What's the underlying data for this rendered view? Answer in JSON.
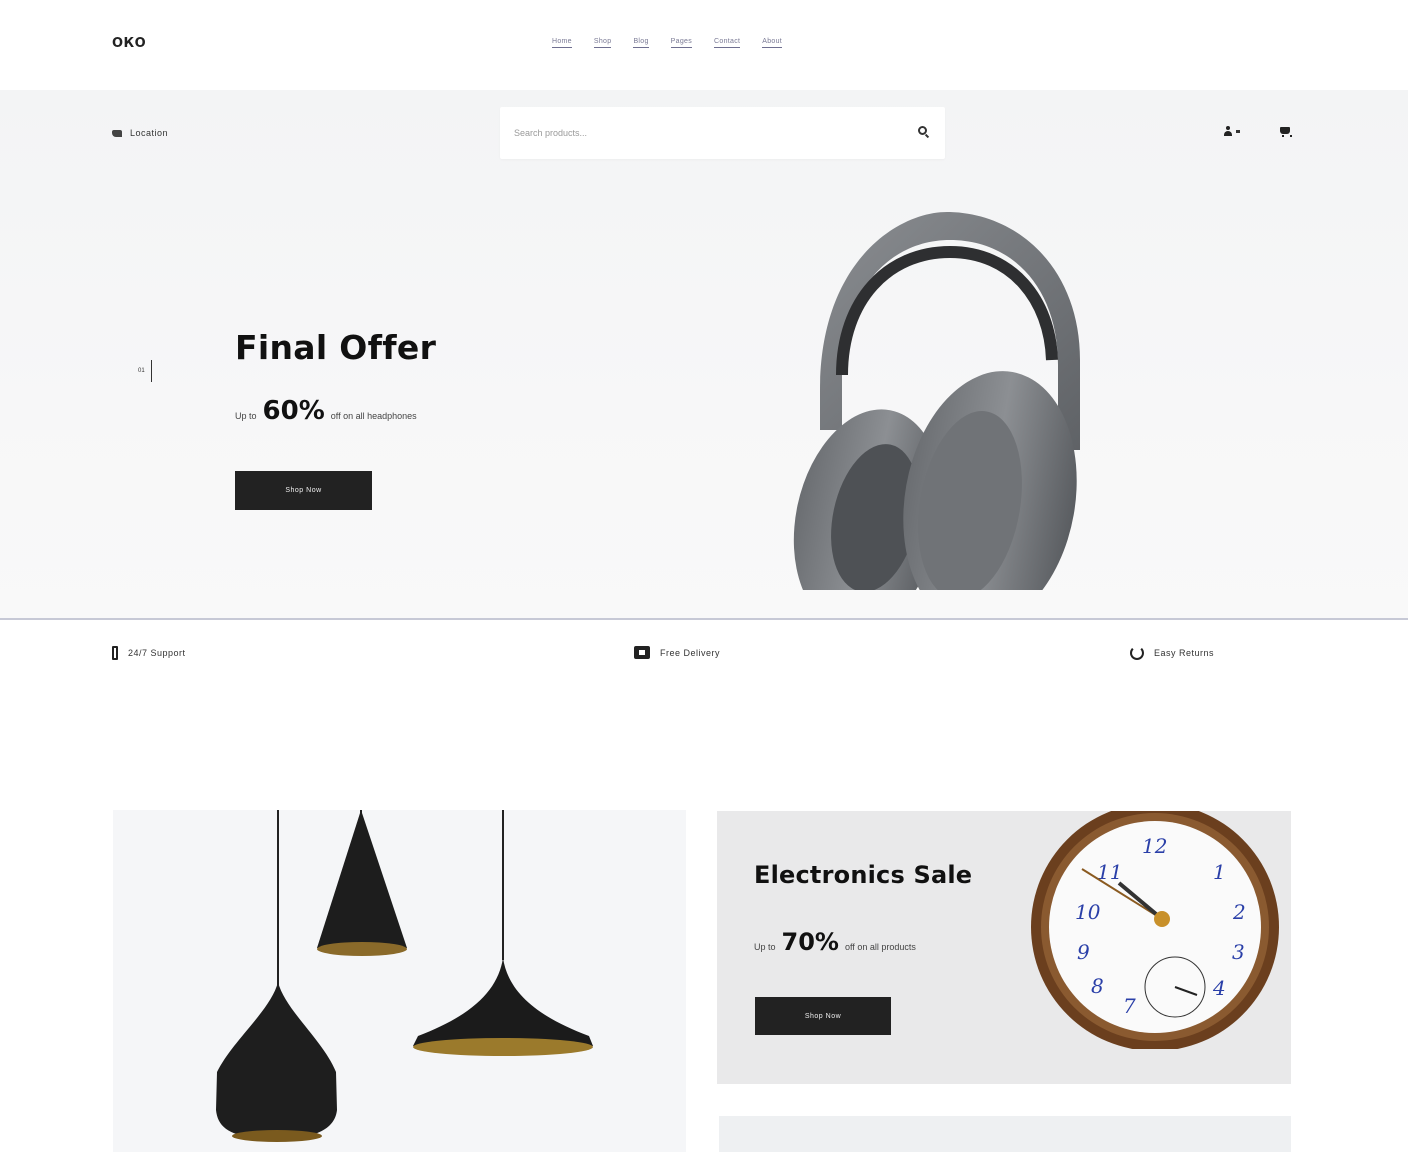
{
  "header": {
    "logo": "ОКО",
    "nav": [
      "Home",
      "Shop",
      "Blog",
      "Pages",
      "Contact",
      "About"
    ]
  },
  "toolbar": {
    "location_label": "Location",
    "search_placeholder": "Search products...",
    "account_label": "Account"
  },
  "hero": {
    "slide_number": "01",
    "title": "Final Offer",
    "offer_prefix": "Up to",
    "offer_value": "60%",
    "offer_suffix": "off on all headphones",
    "button_label": "Shop Now"
  },
  "features": [
    {
      "icon": "phone-icon",
      "label": "24/7 Support"
    },
    {
      "icon": "receipt-icon",
      "label": "Free Delivery"
    },
    {
      "icon": "refresh-icon",
      "label": "Easy Returns"
    }
  ],
  "promos": {
    "clock": {
      "title": "Electronics Sale",
      "offer_prefix": "Up to",
      "offer_value": "70%",
      "offer_suffix": "off on all products",
      "button_label": "Shop Now"
    }
  },
  "colors": {
    "dark_button": "#222222",
    "hero_bg": "#f3f4f5",
    "nav_underline": "#6f6f90"
  }
}
